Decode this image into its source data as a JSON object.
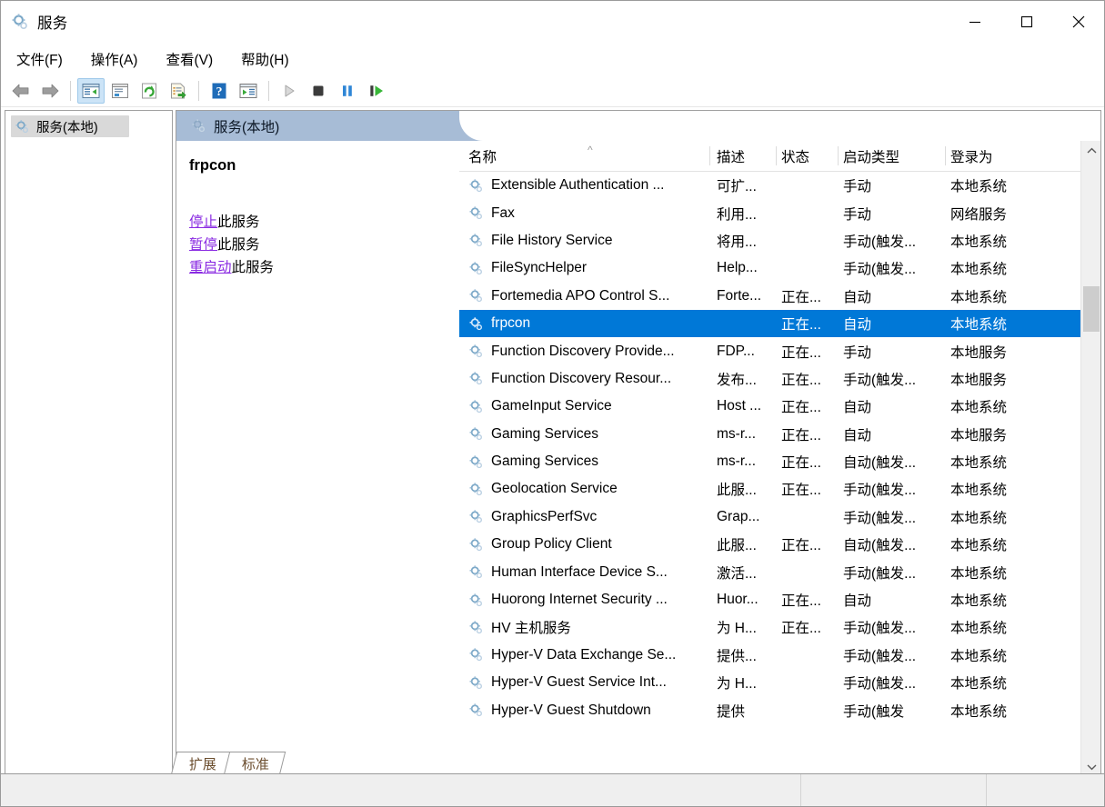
{
  "window": {
    "title": "服务",
    "icon": "services-gear-icon",
    "controls": {
      "minimize": "minimize-icon",
      "maximize": "maximize-icon",
      "close": "close-icon"
    }
  },
  "menubar": {
    "items": [
      {
        "label": "文件(F)",
        "name": "menu-file"
      },
      {
        "label": "操作(A)",
        "name": "menu-action"
      },
      {
        "label": "查看(V)",
        "name": "menu-view"
      },
      {
        "label": "帮助(H)",
        "name": "menu-help"
      }
    ]
  },
  "toolbar": {
    "buttons": [
      {
        "name": "back-button",
        "icon": "arrow-left-icon",
        "enabled": false
      },
      {
        "name": "forward-button",
        "icon": "arrow-right-icon",
        "enabled": false
      },
      {
        "name": "show-hide-console-tree-button",
        "icon": "console-tree-icon",
        "active": true
      },
      {
        "name": "properties-button",
        "icon": "properties-window-icon"
      },
      {
        "name": "refresh-button",
        "icon": "refresh-icon"
      },
      {
        "name": "export-list-button",
        "icon": "export-list-icon"
      },
      {
        "name": "help-button",
        "icon": "help-question-icon"
      },
      {
        "name": "show-action-pane-button",
        "icon": "action-pane-icon"
      },
      {
        "name": "start-service-button",
        "icon": "play-icon",
        "enabled": false
      },
      {
        "name": "stop-service-button",
        "icon": "stop-square-icon"
      },
      {
        "name": "pause-service-button",
        "icon": "pause-bars-icon"
      },
      {
        "name": "restart-service-button",
        "icon": "restart-play-icon"
      }
    ]
  },
  "tree": {
    "nodes": [
      {
        "label": "服务(本地)",
        "name": "tree-node-services-local",
        "selected": true
      }
    ]
  },
  "pane_header": {
    "title": "服务(本地)",
    "icon": "services-gear-icon"
  },
  "details": {
    "service_name": "frpcon",
    "actions": [
      {
        "link": "停止",
        "suffix": "此服务",
        "name": "stop-service-link"
      },
      {
        "link": "暂停",
        "suffix": "此服务",
        "name": "pause-service-link"
      },
      {
        "link": "重启动",
        "suffix": "此服务",
        "name": "restart-service-link"
      }
    ],
    "link_color": "#8a2be2"
  },
  "list": {
    "columns": [
      {
        "label": "名称",
        "name": "column-header-name",
        "sort": "asc"
      },
      {
        "label": "描述",
        "name": "column-header-description"
      },
      {
        "label": "状态",
        "name": "column-header-status"
      },
      {
        "label": "启动类型",
        "name": "column-header-startup-type"
      },
      {
        "label": "登录为",
        "name": "column-header-log-on-as"
      }
    ],
    "sort_indicator": "^",
    "selection_color": "#0078d7",
    "rows": [
      {
        "name": "Extensible Authentication ...",
        "description": "可扩...",
        "status": "",
        "startup": "手动",
        "logon": "本地系统",
        "selected": false
      },
      {
        "name": "Fax",
        "description": "利用...",
        "status": "",
        "startup": "手动",
        "logon": "网络服务",
        "selected": false
      },
      {
        "name": "File History Service",
        "description": "将用...",
        "status": "",
        "startup": "手动(触发...",
        "logon": "本地系统",
        "selected": false
      },
      {
        "name": "FileSyncHelper",
        "description": "Help...",
        "status": "",
        "startup": "手动(触发...",
        "logon": "本地系统",
        "selected": false
      },
      {
        "name": "Fortemedia APO Control S...",
        "description": "Forte...",
        "status": "正在...",
        "startup": "自动",
        "logon": "本地系统",
        "selected": false
      },
      {
        "name": "frpcon",
        "description": "",
        "status": "正在...",
        "startup": "自动",
        "logon": "本地系统",
        "selected": true
      },
      {
        "name": "Function Discovery Provide...",
        "description": "FDP...",
        "status": "正在...",
        "startup": "手动",
        "logon": "本地服务",
        "selected": false
      },
      {
        "name": "Function Discovery Resour...",
        "description": "发布...",
        "status": "正在...",
        "startup": "手动(触发...",
        "logon": "本地服务",
        "selected": false
      },
      {
        "name": "GameInput Service",
        "description": "Host ...",
        "status": "正在...",
        "startup": "自动",
        "logon": "本地系统",
        "selected": false
      },
      {
        "name": "Gaming Services",
        "description": "ms-r...",
        "status": "正在...",
        "startup": "自动",
        "logon": "本地服务",
        "selected": false
      },
      {
        "name": "Gaming Services",
        "description": "ms-r...",
        "status": "正在...",
        "startup": "自动(触发...",
        "logon": "本地系统",
        "selected": false
      },
      {
        "name": "Geolocation Service",
        "description": "此服...",
        "status": "正在...",
        "startup": "手动(触发...",
        "logon": "本地系统",
        "selected": false
      },
      {
        "name": "GraphicsPerfSvc",
        "description": "Grap...",
        "status": "",
        "startup": "手动(触发...",
        "logon": "本地系统",
        "selected": false
      },
      {
        "name": "Group Policy Client",
        "description": "此服...",
        "status": "正在...",
        "startup": "自动(触发...",
        "logon": "本地系统",
        "selected": false
      },
      {
        "name": "Human Interface Device S...",
        "description": "激活...",
        "status": "",
        "startup": "手动(触发...",
        "logon": "本地系统",
        "selected": false
      },
      {
        "name": "Huorong Internet Security ...",
        "description": "Huor...",
        "status": "正在...",
        "startup": "自动",
        "logon": "本地系统",
        "selected": false
      },
      {
        "name": "HV 主机服务",
        "description": "为 H...",
        "status": "正在...",
        "startup": "手动(触发...",
        "logon": "本地系统",
        "selected": false
      },
      {
        "name": "Hyper-V Data Exchange Se...",
        "description": "提供...",
        "status": "",
        "startup": "手动(触发...",
        "logon": "本地系统",
        "selected": false
      },
      {
        "name": "Hyper-V Guest Service Int...",
        "description": "为 H...",
        "status": "",
        "startup": "手动(触发...",
        "logon": "本地系统",
        "selected": false
      },
      {
        "name": "Hyper-V Guest Shutdown",
        "description": "提供",
        "status": "",
        "startup": "手动(触发",
        "logon": "本地系统",
        "selected": false
      }
    ]
  },
  "scrollbar": {
    "up_arrow": "chevron-up-icon",
    "down_arrow": "chevron-down-icon"
  },
  "tabs": [
    {
      "label": "扩展",
      "name": "tab-extended",
      "selected": false
    },
    {
      "label": "标准",
      "name": "tab-standard",
      "selected": true
    }
  ],
  "statusbar": {
    "main": "",
    "cell_a": "",
    "cell_b": ""
  }
}
